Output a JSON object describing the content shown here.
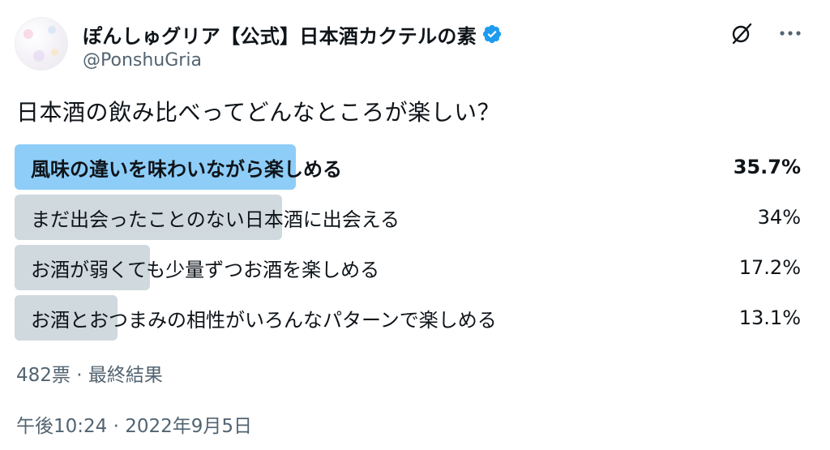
{
  "author": {
    "display_name": "ぽんしゅグリア【公式】日本酒カクテルの素",
    "handle": "@PonshuGria",
    "verified": true
  },
  "icons": {
    "verified": "verified-badge-icon",
    "grok": "grok-icon",
    "more": "more-icon"
  },
  "tweet": {
    "text": "日本酒の飲み比べってどんなところが楽しい？"
  },
  "poll": {
    "options": [
      {
        "label": "風味の違いを味わいながら楽しめる",
        "percent_text": "35.7%",
        "percent": 35.7,
        "winner": true
      },
      {
        "label": "まだ出会ったことのない日本酒に出会える",
        "percent_text": "34%",
        "percent": 34,
        "winner": false
      },
      {
        "label": "お酒が弱くても少量ずつお酒を楽しめる",
        "percent_text": "17.2%",
        "percent": 17.2,
        "winner": false
      },
      {
        "label": "お酒とおつまみの相性がいろんなパターンで楽しめる",
        "percent_text": "13.1%",
        "percent": 13.1,
        "winner": false
      }
    ],
    "summary": "482票 · 最終結果"
  },
  "timestamp": "午後10:24 · 2022年9月5日",
  "colors": {
    "winner_bar": "#8ecdf8",
    "other_bar": "#cfd9de",
    "verified": "#1d9bf0",
    "secondary_text": "#536471"
  }
}
